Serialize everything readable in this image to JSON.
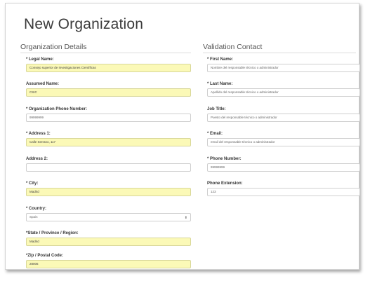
{
  "page": {
    "title": "New Organization"
  },
  "org": {
    "heading": "Organization Details",
    "fields": [
      {
        "label": "* Legal Name:",
        "value": "Consejo superior de Investigaciones Científicas",
        "filled": true
      },
      {
        "label": "Assumed Name:",
        "value": "CSIC",
        "filled": true
      },
      {
        "label": "* Organization Phone Number:",
        "value": "99999999",
        "filled": false
      },
      {
        "label": "* Address 1:",
        "value": "Calle Serrano, 117",
        "filled": true
      },
      {
        "label": "Address 2:",
        "value": "",
        "filled": false
      },
      {
        "label": "* City:",
        "value": "Madrid",
        "filled": true
      },
      {
        "label": "* Country:",
        "value": "Spain",
        "filled": false
      },
      {
        "label": "*State / Province / Region:",
        "value": "Madrid",
        "filled": true
      },
      {
        "label": "*Zip / Postal Code:",
        "value": "28006",
        "filled": true
      }
    ]
  },
  "contact": {
    "heading": "Validation Contact",
    "fields": [
      {
        "label": "* First Name:",
        "placeholder": "Nombre del responsable técnico o administrador"
      },
      {
        "label": "* Last Name:",
        "placeholder": "Apellido del responsable técnico o administrador"
      },
      {
        "label": "Job Title:",
        "placeholder": "Puesto del responsable técnico o administrador"
      },
      {
        "label": "* Email:",
        "placeholder": "email del responsable técnico o administrador"
      },
      {
        "label": "* Phone Number:",
        "placeholder": "99999999"
      },
      {
        "label": "Phone Extension:",
        "placeholder": "123"
      }
    ]
  },
  "icons": {
    "select_caret": "up-down-caret-icon"
  },
  "colors": {
    "filled_bg": "#fbf9b7",
    "border": "#cfcfcf"
  }
}
